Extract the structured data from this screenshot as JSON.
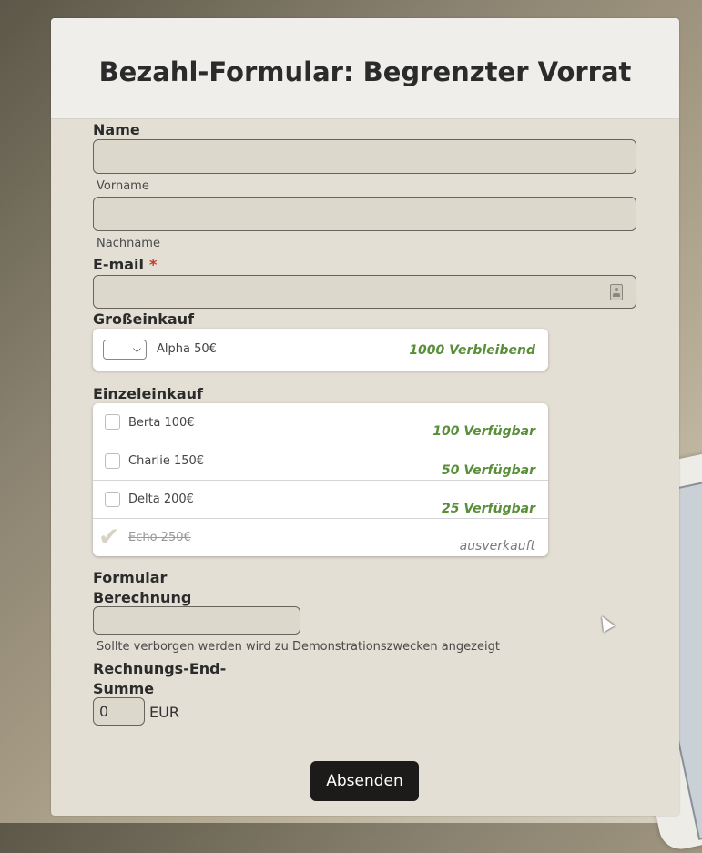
{
  "form": {
    "title": "Bezahl-Formular: Begrenzter Vorrat",
    "name_label": "Name",
    "first_name_sublabel": "Vorname",
    "last_name_sublabel": "Nachname",
    "email_label": "E-mail",
    "required_marker": "*",
    "bulk": {
      "label": "Großeinkauf",
      "option": "Alpha 50€",
      "availability": "1000 Verbleibend"
    },
    "single": {
      "label": "Einzeleinkauf",
      "items": [
        {
          "name": "Berta 100€",
          "availability": "100 Verfügbar"
        },
        {
          "name": "Charlie 150€",
          "availability": "50 Verfügbar"
        },
        {
          "name": "Delta 200€",
          "availability": "25 Verfügbar"
        },
        {
          "name": "Echo 250€",
          "availability": "ausverkauft"
        }
      ]
    },
    "calc": {
      "label_line1": "Formular",
      "label_line2": "Berechnung",
      "hint": "Sollte verborgen werden wird zu Demonstrationszwecken angezeigt"
    },
    "total": {
      "label_line1": "Rechnungs-End-",
      "label_line2": "Summe",
      "value": "0",
      "currency": "EUR"
    },
    "submit_label": "Absenden"
  },
  "colors": {
    "accent_available": "#5a8f3a",
    "required": "#c0392b",
    "button": "#1c1b19"
  },
  "icons": [
    "contact-card-icon",
    "chevron-down-icon",
    "checkmark-icon",
    "mouse-cursor-icon"
  ]
}
